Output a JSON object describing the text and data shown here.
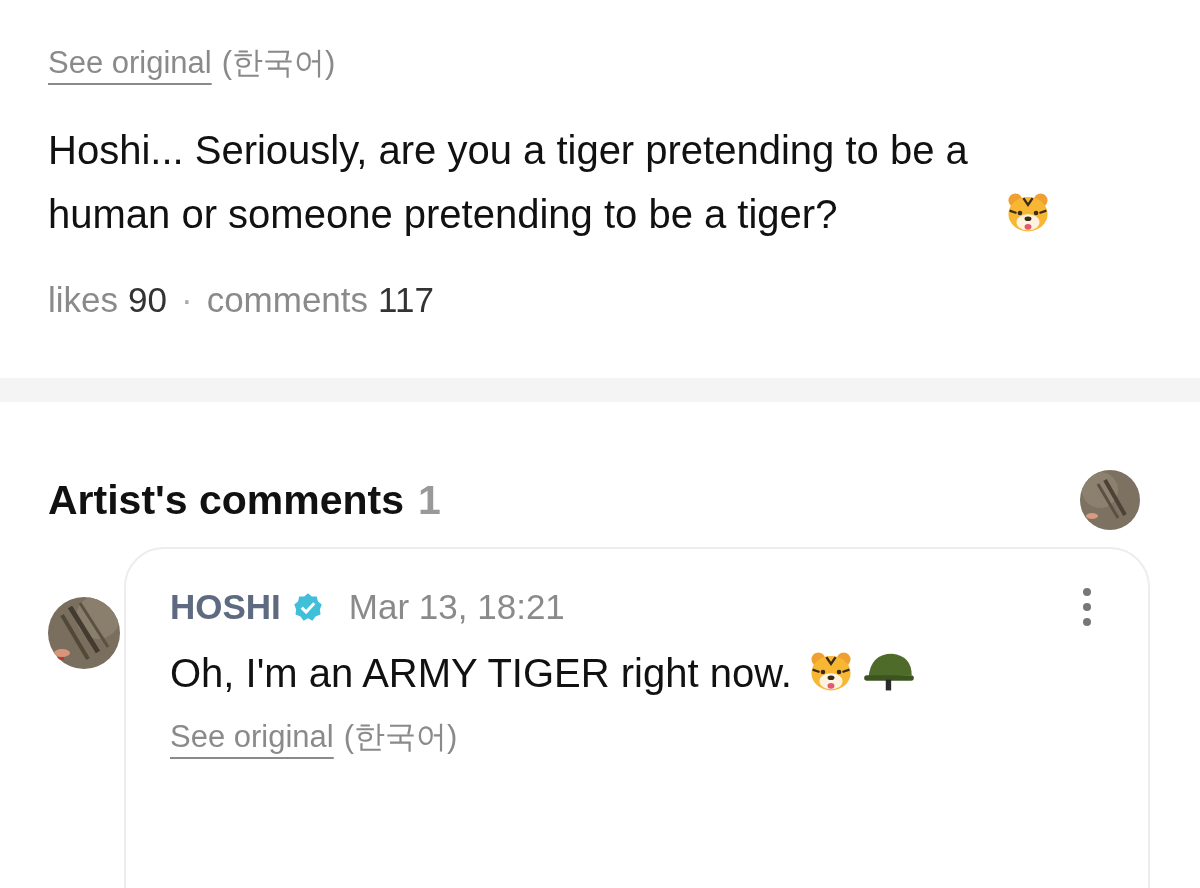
{
  "translation_link": {
    "label": "See original",
    "language": "(한국어)"
  },
  "post": {
    "text": "Hoshi... Seriously, are you a tiger pretending to be a human or someone pretending to be a tiger?",
    "likes_label": "likes",
    "likes": "90",
    "separator": "·",
    "comments_label": "comments",
    "comments": "117"
  },
  "artist_comments": {
    "title": "Artist's comments",
    "count": "1",
    "comments": [
      {
        "author": "HOSHI",
        "verified": true,
        "time": "Mar 13, 18:21",
        "text": "Oh, I'm an ARMY TIGER right now.",
        "translation_link": {
          "label": "See original",
          "language": "(한국어)"
        }
      }
    ]
  }
}
